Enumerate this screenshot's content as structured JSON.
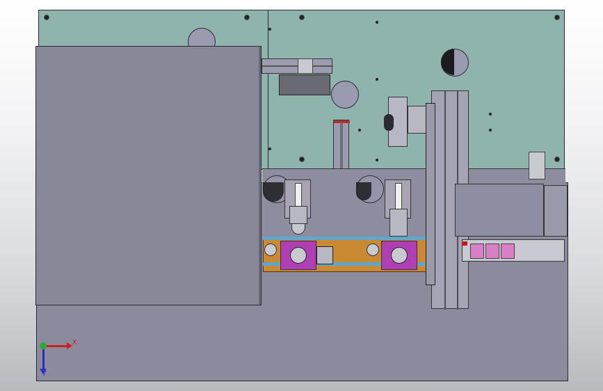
{
  "view": {
    "triad": {
      "x_label": "X",
      "y_label": "Y",
      "x_color": "#cc1f1f",
      "y_color": "#2a31b8",
      "origin_color": "#2fa83a"
    }
  },
  "colors": {
    "background_top": "#ffffff",
    "background_bottom": "#b9babf",
    "plate_teal": "#8fb3ad",
    "plate_grey": "#8a8a9e",
    "accent_purple": "#b13fb4",
    "accent_orange": "#c98a33",
    "accent_pink": "#d780c6"
  }
}
